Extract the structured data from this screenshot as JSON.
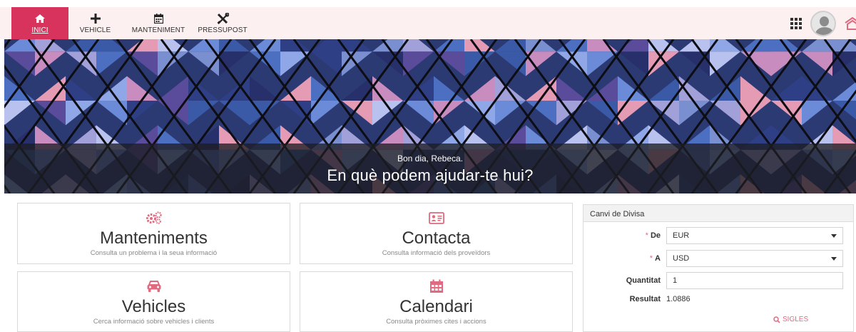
{
  "nav": {
    "items": [
      {
        "label": "INICI",
        "icon": "home-icon",
        "active": true
      },
      {
        "label": "VEHICLE",
        "icon": "plus-icon"
      },
      {
        "label": "MANTENIMENT",
        "icon": "calendar-icon"
      },
      {
        "label": "PRESSUPOST",
        "icon": "tools-icon"
      }
    ]
  },
  "header_right": {
    "apps_icon": "apps-grid-icon",
    "avatar": "user-avatar",
    "logout_icon": "logout-icon"
  },
  "hero": {
    "greeting": "Bon dia, Rebeca.",
    "question": "En què podem ajudar-te hui?"
  },
  "cards": [
    {
      "title": "Manteniments",
      "subtitle": "Consulta un problema i la seua informació",
      "icon": "gears-icon"
    },
    {
      "title": "Contacta",
      "subtitle": "Consulta informació dels proveïdors",
      "icon": "contact-card-icon"
    },
    {
      "title": "Vehicles",
      "subtitle": "Cerca informació sobre vehicles i clients",
      "icon": "car-icon"
    },
    {
      "title": "Calendari",
      "subtitle": "Consulta pròximes cites i accions",
      "icon": "calendar-icon"
    }
  ],
  "currency": {
    "title": "Canvi de Divisa",
    "from_label": "De",
    "from_value": "EUR",
    "to_label": "A",
    "to_value": "USD",
    "amount_label": "Quantitat",
    "amount_value": "1",
    "result_label": "Resultat",
    "result_value": "1.0886",
    "sigles_label": "SIGLES",
    "required_mark": "*"
  },
  "colors": {
    "accent": "#d8335c",
    "accent_light": "#e06a80",
    "nav_bg": "#fdf0f0"
  }
}
